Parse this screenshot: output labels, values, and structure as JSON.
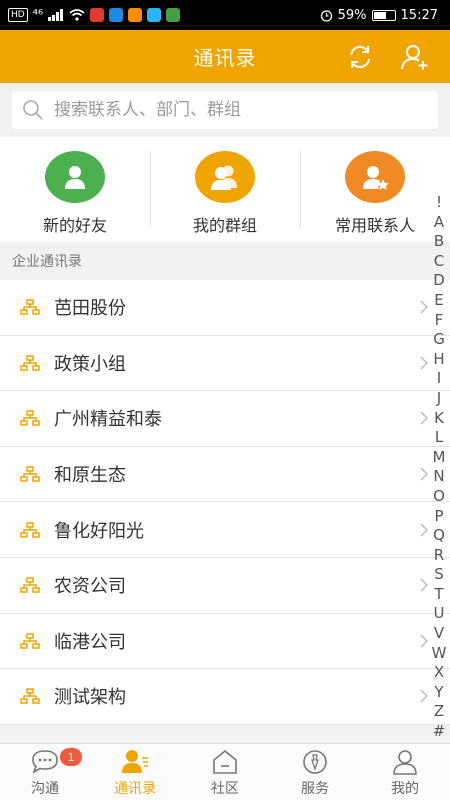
{
  "status_bar": {
    "left_chips": [
      "HD",
      "⁴⁶"
    ],
    "battery": "59%",
    "time": "15:27"
  },
  "header": {
    "title": "通讯录",
    "icons": [
      "refresh-icon",
      "add-contact-icon"
    ]
  },
  "search": {
    "placeholder": "搜索联系人、部门、群组"
  },
  "quick_actions": [
    {
      "label": "新的好友",
      "color": "#4caf50",
      "icon": "person-icon"
    },
    {
      "label": "我的群组",
      "color": "#f0a400",
      "icon": "group-icon"
    },
    {
      "label": "常用联系人",
      "color": "#f08a24",
      "icon": "star-person-icon"
    }
  ],
  "section": {
    "title": "企业通讯录"
  },
  "org_list": [
    {
      "label": "芭田股份"
    },
    {
      "label": "政策小组"
    },
    {
      "label": "广州精益和泰"
    },
    {
      "label": "和原生态"
    },
    {
      "label": "鲁化好阳光"
    },
    {
      "label": "农资公司"
    },
    {
      "label": "临港公司"
    },
    {
      "label": "测试架构"
    }
  ],
  "index_letters": [
    "!",
    "A",
    "B",
    "C",
    "D",
    "E",
    "F",
    "G",
    "H",
    "I",
    "J",
    "K",
    "L",
    "M",
    "N",
    "O",
    "P",
    "Q",
    "R",
    "S",
    "T",
    "U",
    "V",
    "W",
    "X",
    "Y",
    "Z",
    "#"
  ],
  "tabs": [
    {
      "label": "沟通",
      "badge": "1",
      "icon": "chat-icon"
    },
    {
      "label": "通讯录",
      "icon": "contacts-icon",
      "active": true
    },
    {
      "label": "社区",
      "icon": "community-icon"
    },
    {
      "label": "服务",
      "icon": "service-icon"
    },
    {
      "label": "我的",
      "icon": "profile-icon"
    }
  ],
  "colors": {
    "accent": "#f0a400",
    "badge": "#f05a3c"
  }
}
